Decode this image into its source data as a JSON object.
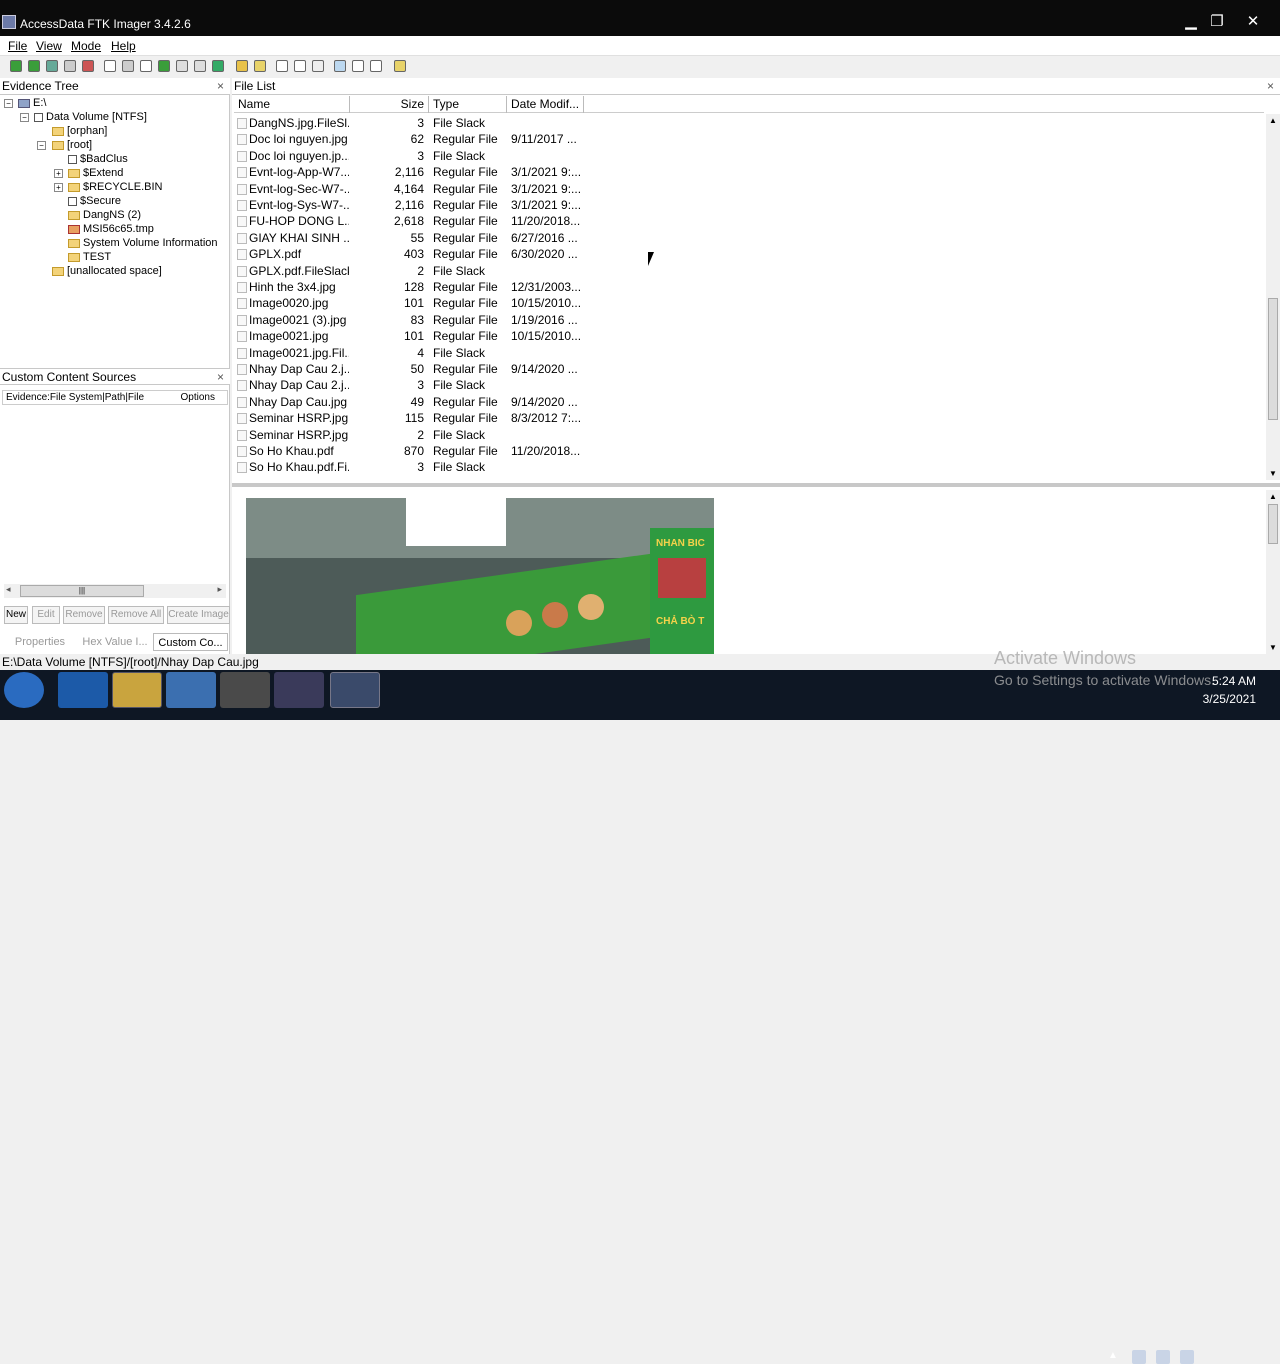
{
  "window": {
    "title": "AccessData FTK Imager 3.4.2.6",
    "minimize": "▁",
    "maximize": "❐",
    "close": "✕"
  },
  "menu": [
    {
      "label": "File"
    },
    {
      "label": "View"
    },
    {
      "label": "Mode"
    },
    {
      "label": "Help"
    }
  ],
  "evidence_tree": {
    "title": "Evidence Tree",
    "close": "×",
    "items": [
      {
        "label": "E:\\"
      },
      {
        "label": "Data Volume [NTFS]"
      },
      {
        "label": "[orphan]"
      },
      {
        "label": "[root]"
      },
      {
        "label": "$BadClus"
      },
      {
        "label": "$Extend"
      },
      {
        "label": "$RECYCLE.BIN"
      },
      {
        "label": "$Secure"
      },
      {
        "label": "DangNS (2)"
      },
      {
        "label": "MSI56c65.tmp"
      },
      {
        "label": "System Volume Information"
      },
      {
        "label": "TEST"
      },
      {
        "label": "[unallocated space]"
      }
    ]
  },
  "custom_content": {
    "title": "Custom Content Sources",
    "close": "×",
    "col_path": "Evidence:File System|Path|File",
    "col_options": "Options",
    "buttons": {
      "new": "New",
      "edit": "Edit",
      "remove": "Remove",
      "remove_all": "Remove All",
      "create_image": "Create Image"
    }
  },
  "bottom_tabs": {
    "properties": "Properties",
    "hex": "Hex Value I...",
    "custom": "Custom Co..."
  },
  "file_list": {
    "title": "File List",
    "close": "×",
    "columns": {
      "name": "Name",
      "size": "Size",
      "type": "Type",
      "date": "Date Modif..."
    },
    "rows": [
      {
        "name": "DangNS.jpg.FileSl...",
        "size": "3",
        "type": "File Slack",
        "date": ""
      },
      {
        "name": "Doc loi nguyen.jpg",
        "size": "62",
        "type": "Regular File",
        "date": "9/11/2017 ..."
      },
      {
        "name": "Doc loi nguyen.jp...",
        "size": "3",
        "type": "File Slack",
        "date": ""
      },
      {
        "name": "Evnt-log-App-W7...",
        "size": "2,116",
        "type": "Regular File",
        "date": "3/1/2021 9:..."
      },
      {
        "name": "Evnt-log-Sec-W7-...",
        "size": "4,164",
        "type": "Regular File",
        "date": "3/1/2021 9:..."
      },
      {
        "name": "Evnt-log-Sys-W7-...",
        "size": "2,116",
        "type": "Regular File",
        "date": "3/1/2021 9:..."
      },
      {
        "name": "FU-HOP DONG L...",
        "size": "2,618",
        "type": "Regular File",
        "date": "11/20/2018..."
      },
      {
        "name": "GIAY KHAI SINH ...",
        "size": "55",
        "type": "Regular File",
        "date": "6/27/2016 ..."
      },
      {
        "name": "GPLX.pdf",
        "size": "403",
        "type": "Regular File",
        "date": "6/30/2020 ..."
      },
      {
        "name": "GPLX.pdf.FileSlack",
        "size": "2",
        "type": "File Slack",
        "date": ""
      },
      {
        "name": "Hinh the 3x4.jpg",
        "size": "128",
        "type": "Regular File",
        "date": "12/31/2003..."
      },
      {
        "name": "Image0020.jpg",
        "size": "101",
        "type": "Regular File",
        "date": "10/15/2010..."
      },
      {
        "name": "Image0021 (3).jpg",
        "size": "83",
        "type": "Regular File",
        "date": "1/19/2016 ..."
      },
      {
        "name": "Image0021.jpg",
        "size": "101",
        "type": "Regular File",
        "date": "10/15/2010..."
      },
      {
        "name": "Image0021.jpg.Fil...",
        "size": "4",
        "type": "File Slack",
        "date": ""
      },
      {
        "name": "Nhay Dap Cau 2.j...",
        "size": "50",
        "type": "Regular File",
        "date": "9/14/2020 ..."
      },
      {
        "name": "Nhay Dap Cau 2.j...",
        "size": "3",
        "type": "File Slack",
        "date": ""
      },
      {
        "name": "Nhay Dap Cau.jpg",
        "size": "49",
        "type": "Regular File",
        "date": "9/14/2020 ..."
      },
      {
        "name": "Seminar HSRP.jpg",
        "size": "115",
        "type": "Regular File",
        "date": "8/3/2012 7:..."
      },
      {
        "name": "Seminar HSRP.jpg...",
        "size": "2",
        "type": "File Slack",
        "date": ""
      },
      {
        "name": "So Ho Khau.pdf",
        "size": "870",
        "type": "Regular File",
        "date": "11/20/2018..."
      },
      {
        "name": "So Ho Khau.pdf.Fi...",
        "size": "3",
        "type": "File Slack",
        "date": ""
      }
    ]
  },
  "preview": {
    "sign_text": "NHAN BIC",
    "sign_text2": "CHẢ BÒ T"
  },
  "status": {
    "path": "E:\\Data Volume [NTFS]/[root]/Nhay Dap Cau.jpg"
  },
  "watermark": {
    "line1": "Activate Windows",
    "line2": "Go to Settings to activate Windows."
  },
  "taskbar": {
    "time": "5:24 AM",
    "date": "3/25/2021"
  }
}
